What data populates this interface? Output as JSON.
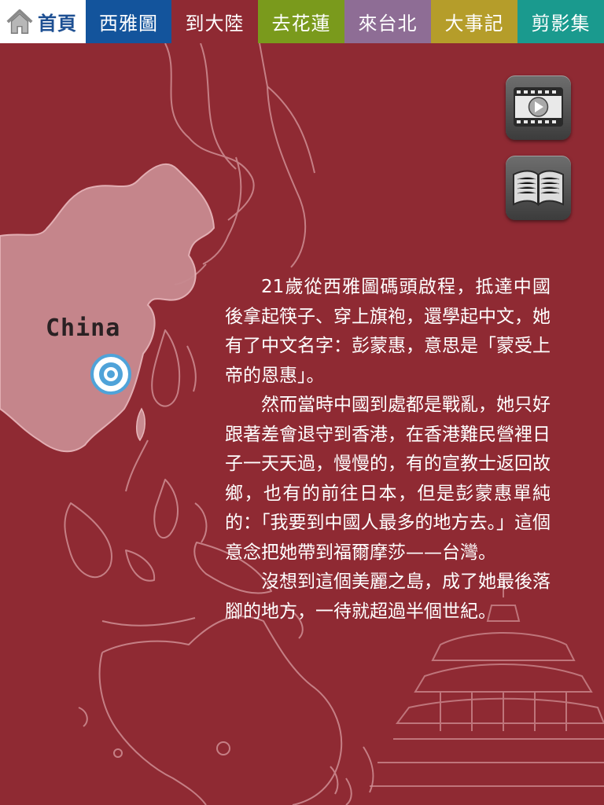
{
  "nav": {
    "home_label": "首頁",
    "tabs": [
      {
        "label": "西雅圖",
        "color": "#13549c"
      },
      {
        "label": "到大陸",
        "color": "#8f2a33"
      },
      {
        "label": "去花蓮",
        "color": "#7a9a1c"
      },
      {
        "label": "來台北",
        "color": "#8e6d95"
      },
      {
        "label": "大事記",
        "color": "#b59d2a"
      },
      {
        "label": "剪影集",
        "color": "#1a9a8e"
      }
    ]
  },
  "map": {
    "country_label": "China",
    "pin_icon": "location-pin-icon",
    "background_color": "#8f2a33"
  },
  "side_buttons": {
    "video_icon": "film-play-icon",
    "book_icon": "open-book-icon"
  },
  "story": {
    "paragraphs": [
      "21歲從西雅圖碼頭啟程，抵達中國後拿起筷子、穿上旗袍，還學起中文，她有了中文名字：彭蒙惠，意思是「蒙受上帝的恩惠」。",
      "然而當時中國到處都是戰亂，她只好跟著差會退守到香港，在香港難民營裡日子一天天過，慢慢的，有的宣教士返回故鄉，也有的前往日本，但是彭蒙惠單純的：「我要到中國人最多的地方去。」這個意念把她帶到福爾摩莎——台灣。",
      "沒想到這個美麗之島，成了她最後落腳的地方，一待就超過半個世紀。"
    ]
  }
}
